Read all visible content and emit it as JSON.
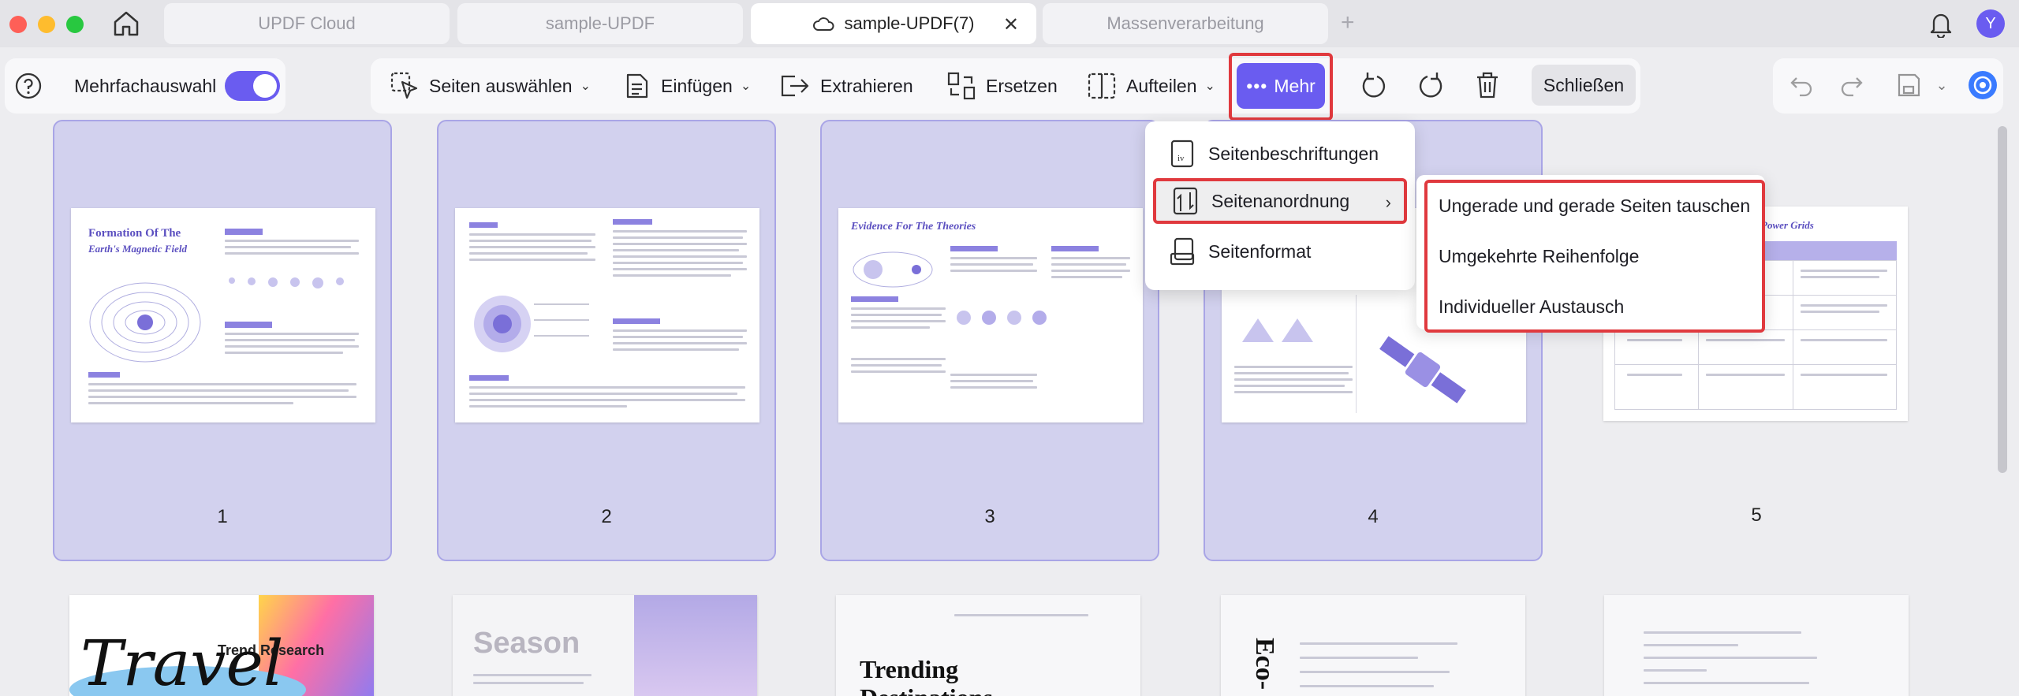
{
  "tabs": [
    {
      "label": "UPDF Cloud",
      "active": false
    },
    {
      "label": "sample-UPDF",
      "active": false
    },
    {
      "label": "sample-UPDF(7)",
      "active": true,
      "icon": "cloud-icon"
    },
    {
      "label": "Massenverarbeitung",
      "active": false
    }
  ],
  "user": {
    "initial": "Y"
  },
  "toolbar": {
    "multi_select_label": "Mehrfachauswahl",
    "select_pages": "Seiten auswählen",
    "insert": "Einfügen",
    "extract": "Extrahieren",
    "replace": "Ersetzen",
    "split": "Aufteilen",
    "more": "Mehr",
    "close": "Schließen"
  },
  "more_menu": {
    "items": [
      {
        "label": "Seitenbeschriftungen",
        "icon": "page-label-icon"
      },
      {
        "label": "Seitenanordnung",
        "icon": "page-arrange-icon",
        "has_submenu": true
      },
      {
        "label": "Seitenformat",
        "icon": "page-format-icon"
      }
    ]
  },
  "submenu": {
    "items": [
      "Ungerade und gerade Seiten tauschen",
      "Umgekehrte Reihenfolge",
      "Individueller Austausch"
    ]
  },
  "pages": [
    {
      "number": "1",
      "selected": true,
      "title_line1": "Formation Of The",
      "title_line2": "Earth's Magnetic Field"
    },
    {
      "number": "2",
      "selected": true
    },
    {
      "number": "3",
      "selected": true,
      "title_line1": "Evidence For The Theories"
    },
    {
      "number": "4",
      "selected": true
    },
    {
      "number": "5",
      "selected": false,
      "title_line1": "Power Grids"
    }
  ],
  "row2": [
    {
      "text1": "Trend Research",
      "text2": "Travel"
    },
    {
      "text1": "Season"
    },
    {
      "text1": "Trending",
      "text2": "Destinations"
    },
    {
      "text1": "Eco-"
    },
    {
      "text1": ""
    }
  ],
  "colors": {
    "accent": "#6a5cf0",
    "highlight": "#e0393e",
    "selected_card": "#d2d1ee"
  }
}
